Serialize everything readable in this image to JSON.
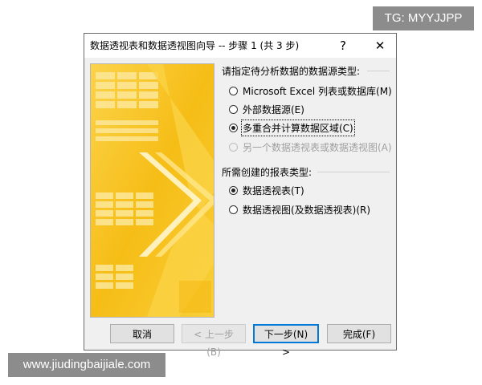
{
  "watermarks": {
    "top_right": "TG: MYYJJPP",
    "bottom_left": "www.jiudingbaijiale.com"
  },
  "dialog": {
    "title": "数据透视表和数据透视图向导 -- 步骤 1 (共 3 步)",
    "help_glyph": "?",
    "close_glyph": "✕",
    "section1_label": "请指定待分析数据的数据源类型:",
    "source_options": [
      {
        "label": "Microsoft Excel 列表或数据库(M)",
        "checked": false,
        "disabled": false
      },
      {
        "label": "外部数据源(E)",
        "checked": false,
        "disabled": false
      },
      {
        "label": "多重合并计算数据区域(C)",
        "checked": true,
        "disabled": false
      },
      {
        "label": "另一个数据透视表或数据透视图(A)",
        "checked": false,
        "disabled": true
      }
    ],
    "section2_label": "所需创建的报表类型:",
    "report_options": [
      {
        "label": "数据透视表(T)",
        "checked": true,
        "disabled": false
      },
      {
        "label": "数据透视图(及数据透视表)(R)",
        "checked": false,
        "disabled": false
      }
    ],
    "buttons": {
      "cancel": "取消",
      "back": "< 上一步(B)",
      "next": "下一步(N) >",
      "finish": "完成(F)"
    }
  },
  "colors": {
    "accent_blue": "#0078d7",
    "art_yellow": "#f7c21b",
    "art_light": "#fde89a"
  }
}
